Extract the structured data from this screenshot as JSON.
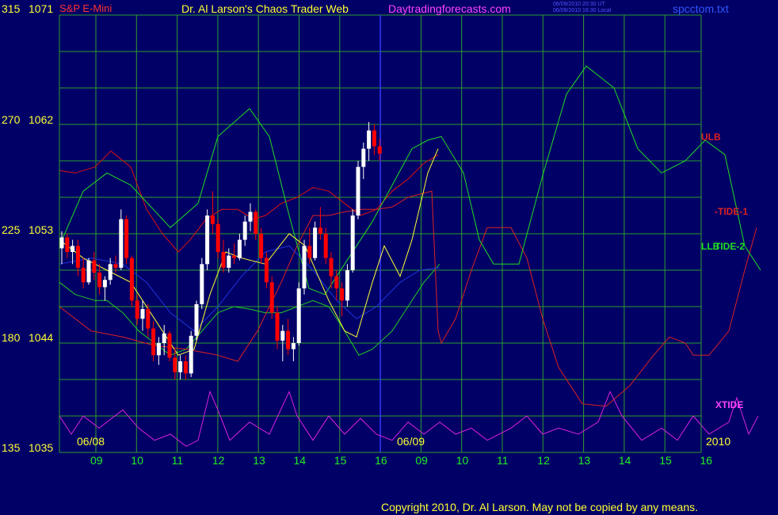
{
  "header": {
    "left_title": "S&P E-Mini",
    "center_title": "Dr. Al Larson's Chaos Trader Web",
    "site": "Daytradingforecasts.com",
    "timestamp_1": "06/09/2010 20:30 UT",
    "timestamp_2": "06/09/2010 16:30 Local",
    "file": "spcctom.txt"
  },
  "footer": {
    "copyright": "Copyright 2010, Dr. Al Larson. May not be copied by any means."
  },
  "colors": {
    "background": "#000066",
    "grid": "#2e9e2e",
    "price_up": "#ffffff",
    "price_down": "#ff0000",
    "ulb": "#dd1111",
    "llb": "#22cc22",
    "tide1": "#dd2222",
    "tide2": "#22dd22",
    "xtide": "#dd22dd",
    "yellow": "#ffff33",
    "blue": "#2233dd",
    "divider": "#3333ff"
  },
  "chart_data": {
    "type": "line",
    "title": "S&P E-Mini",
    "y_left_ticks": [
      {
        "osc": "315",
        "price": "1071"
      },
      {
        "osc": "270",
        "price": "1062"
      },
      {
        "osc": "225",
        "price": "1053"
      },
      {
        "osc": "180",
        "price": "1044"
      },
      {
        "osc": "135",
        "price": "1035"
      }
    ],
    "ylim": [
      1035,
      1071
    ],
    "x_labels": [
      "09",
      "10",
      "11",
      "12",
      "13",
      "14",
      "15",
      "16",
      "09",
      "10",
      "11",
      "12",
      "13",
      "14",
      "15",
      "16"
    ],
    "date_labels": [
      "06/08",
      "06/09"
    ],
    "year_label": "2010",
    "series_labels": [
      "ULB",
      "-TIDE-1",
      "LLB",
      "TIDE-2",
      "XTIDE"
    ],
    "price_bars": [
      [
        0,
        1051.8,
        1053.2,
        1050.5,
        1052.7
      ],
      [
        1,
        1052.7,
        1053,
        1051,
        1051.5
      ],
      [
        2,
        1051.5,
        1052.5,
        1050.5,
        1052
      ],
      [
        3,
        1052,
        1052.5,
        1049.5,
        1050.2
      ],
      [
        4,
        1050.2,
        1051,
        1048.5,
        1049
      ],
      [
        5,
        1049,
        1051,
        1048.8,
        1050.8
      ],
      [
        6,
        1050.8,
        1051.5,
        1049.2,
        1049.8
      ],
      [
        7,
        1049.8,
        1050.5,
        1048,
        1048.6
      ],
      [
        8,
        1048.6,
        1049.5,
        1047.5,
        1049.2
      ],
      [
        9,
        1049.2,
        1051,
        1048.8,
        1050.5
      ],
      [
        10,
        1050.5,
        1051.2,
        1049.8,
        1050.2
      ],
      [
        11,
        1050.2,
        1055,
        1050,
        1054.2
      ],
      [
        12,
        1054.2,
        1054.5,
        1050.5,
        1051
      ],
      [
        13,
        1051,
        1051.2,
        1047,
        1047.5
      ],
      [
        14,
        1047.5,
        1048,
        1045.5,
        1046
      ],
      [
        15,
        1046,
        1047.5,
        1045,
        1046.8
      ],
      [
        16,
        1046.8,
        1047.2,
        1044.5,
        1045.2
      ],
      [
        17,
        1045.2,
        1045.8,
        1042.5,
        1043
      ],
      [
        18,
        1043,
        1044.5,
        1042.2,
        1044
      ],
      [
        19,
        1044,
        1045.5,
        1043,
        1044.8
      ],
      [
        20,
        1044.8,
        1045,
        1042.5,
        1042.8
      ],
      [
        21,
        1042.8,
        1043.5,
        1041,
        1041.6
      ],
      [
        22,
        1041.6,
        1043,
        1041,
        1042.5
      ],
      [
        23,
        1042.5,
        1043,
        1041,
        1041.5
      ],
      [
        24,
        1041.5,
        1045,
        1041.2,
        1044.6
      ],
      [
        25,
        1044.6,
        1047.5,
        1044.2,
        1047.2
      ],
      [
        26,
        1047.2,
        1051,
        1046.8,
        1050.5
      ],
      [
        27,
        1050.5,
        1055,
        1050,
        1054.5
      ],
      [
        28,
        1054.5,
        1056.5,
        1053,
        1053.8
      ],
      [
        29,
        1053.8,
        1054.2,
        1051,
        1051.5
      ],
      [
        30,
        1051.5,
        1052.5,
        1049.8,
        1050.2
      ],
      [
        31,
        1050.2,
        1051.8,
        1049.8,
        1051.2
      ],
      [
        32,
        1051.2,
        1052.2,
        1050.5,
        1051
      ],
      [
        33,
        1051,
        1053,
        1050.8,
        1052.5
      ],
      [
        34,
        1052.5,
        1054.5,
        1052,
        1054
      ],
      [
        35,
        1054,
        1055.5,
        1053.2,
        1054.8
      ],
      [
        36,
        1054.8,
        1055,
        1052.5,
        1053
      ],
      [
        37,
        1053,
        1053.5,
        1050.5,
        1051
      ],
      [
        38,
        1051,
        1051.5,
        1048.5,
        1049
      ],
      [
        39,
        1049,
        1049.5,
        1046,
        1046.5
      ],
      [
        40,
        1046.5,
        1047,
        1043.5,
        1044.2
      ],
      [
        41,
        1044.2,
        1045.5,
        1042.5,
        1045
      ],
      [
        42,
        1045,
        1046,
        1043,
        1043.5
      ],
      [
        43,
        1043.5,
        1044.5,
        1042.5,
        1044
      ],
      [
        44,
        1044,
        1049,
        1043.8,
        1048.5
      ],
      [
        45,
        1048.5,
        1052.5,
        1048,
        1052
      ],
      [
        46,
        1052,
        1053.5,
        1050.5,
        1051
      ],
      [
        47,
        1051,
        1054,
        1050.8,
        1053.5
      ],
      [
        48,
        1053.5,
        1055.2,
        1052.5,
        1053
      ],
      [
        49,
        1053,
        1053.5,
        1050.5,
        1051
      ],
      [
        50,
        1051,
        1051.5,
        1048.5,
        1049.5
      ],
      [
        51,
        1049.5,
        1050,
        1047.5,
        1048.5
      ],
      [
        52,
        1048.5,
        1049,
        1046.2,
        1047.5
      ],
      [
        53,
        1047.5,
        1050.5,
        1047,
        1050
      ],
      [
        54,
        1050,
        1055,
        1049.8,
        1054.5
      ],
      [
        55,
        1054.5,
        1059,
        1054.2,
        1058.5
      ],
      [
        56,
        1058.5,
        1060.5,
        1057.5,
        1060
      ],
      [
        57,
        1060,
        1062.2,
        1059,
        1061.5
      ],
      [
        58,
        1061.5,
        1062,
        1059.5,
        1060.2
      ],
      [
        59,
        1060.2,
        1060.8,
        1059,
        1059.6
      ]
    ],
    "ulb": [
      [
        0,
        1058.2
      ],
      [
        20,
        1058
      ],
      [
        45,
        1058.5
      ],
      [
        65,
        1059.8
      ],
      [
        90,
        1058.5
      ],
      [
        110,
        1055
      ],
      [
        130,
        1053
      ],
      [
        150,
        1051.5
      ],
      [
        165,
        1052.5
      ],
      [
        185,
        1054.2
      ],
      [
        205,
        1055
      ],
      [
        225,
        1055
      ],
      [
        245,
        1054.2
      ],
      [
        260,
        1054.5
      ],
      [
        280,
        1055.5
      ],
      [
        300,
        1056
      ],
      [
        320,
        1056.8
      ],
      [
        340,
        1056.5
      ],
      [
        360,
        1055.5
      ],
      [
        380,
        1054.5
      ],
      [
        400,
        1055
      ],
      [
        420,
        1056.5
      ],
      [
        440,
        1057.5
      ],
      [
        460,
        1058.8
      ],
      [
        478,
        1059.5
      ]
    ],
    "llb": [
      [
        0,
        1049
      ],
      [
        20,
        1048
      ],
      [
        45,
        1047.5
      ],
      [
        60,
        1047.5
      ],
      [
        80,
        1046.5
      ],
      [
        100,
        1045
      ],
      [
        120,
        1044
      ],
      [
        140,
        1043
      ],
      [
        160,
        1043.5
      ],
      [
        180,
        1045
      ],
      [
        200,
        1046.5
      ],
      [
        220,
        1047
      ],
      [
        240,
        1046.8
      ],
      [
        260,
        1046.5
      ],
      [
        280,
        1046.5
      ],
      [
        300,
        1047
      ],
      [
        320,
        1047.5
      ],
      [
        340,
        1047
      ],
      [
        360,
        1045
      ],
      [
        378,
        1043
      ],
      [
        395,
        1043.5
      ],
      [
        420,
        1045
      ],
      [
        440,
        1047
      ],
      [
        460,
        1049
      ],
      [
        480,
        1050.5
      ]
    ],
    "tide1": [
      [
        0,
        1047
      ],
      [
        40,
        1045
      ],
      [
        80,
        1044.5
      ],
      [
        120,
        1043.8
      ],
      [
        160,
        1043.5
      ],
      [
        200,
        1043
      ],
      [
        225,
        1042.5
      ],
      [
        250,
        1045
      ],
      [
        280,
        1049
      ],
      [
        300,
        1052
      ],
      [
        320,
        1054.5
      ],
      [
        340,
        1054.5
      ],
      [
        360,
        1054.8
      ],
      [
        380,
        1055
      ],
      [
        400,
        1055
      ],
      [
        420,
        1055.2
      ],
      [
        440,
        1056
      ],
      [
        470,
        1056.5
      ],
      [
        478,
        1045
      ],
      [
        482,
        1044
      ],
      [
        500,
        1046
      ],
      [
        520,
        1050
      ],
      [
        540,
        1053.5
      ],
      [
        570,
        1053.5
      ],
      [
        590,
        1051
      ],
      [
        610,
        1046
      ],
      [
        630,
        1042
      ],
      [
        660,
        1039
      ],
      [
        690,
        1038.8
      ],
      [
        720,
        1040.5
      ],
      [
        750,
        1043
      ],
      [
        770,
        1044.5
      ],
      [
        790,
        1044
      ],
      [
        800,
        1043
      ],
      [
        820,
        1043
      ],
      [
        845,
        1045
      ],
      [
        865,
        1050
      ],
      [
        880,
        1053.5
      ]
    ],
    "tide2": [
      [
        0,
        1052
      ],
      [
        30,
        1056.5
      ],
      [
        60,
        1058
      ],
      [
        90,
        1057
      ],
      [
        140,
        1053.5
      ],
      [
        175,
        1055.5
      ],
      [
        200,
        1061
      ],
      [
        240,
        1063.3
      ],
      [
        265,
        1061
      ],
      [
        290,
        1054.5
      ],
      [
        315,
        1048.5
      ],
      [
        335,
        1048
      ],
      [
        365,
        1051
      ],
      [
        395,
        1054
      ],
      [
        420,
        1057
      ],
      [
        445,
        1060
      ],
      [
        465,
        1060.7
      ],
      [
        482,
        1061
      ],
      [
        510,
        1058
      ],
      [
        530,
        1052.5
      ],
      [
        548,
        1050.5
      ],
      [
        580,
        1050.5
      ],
      [
        610,
        1057.8
      ],
      [
        640,
        1064.5
      ],
      [
        665,
        1066.8
      ],
      [
        700,
        1065
      ],
      [
        730,
        1060
      ],
      [
        760,
        1058
      ],
      [
        790,
        1059
      ],
      [
        815,
        1060.7
      ],
      [
        840,
        1059.5
      ],
      [
        865,
        1052
      ],
      [
        885,
        1050
      ]
    ],
    "xtide": [
      [
        0,
        1038
      ],
      [
        15,
        1036.5
      ],
      [
        30,
        1038
      ],
      [
        50,
        1037
      ],
      [
        80,
        1038.5
      ],
      [
        100,
        1037
      ],
      [
        120,
        1036
      ],
      [
        140,
        1036.5
      ],
      [
        160,
        1035.5
      ],
      [
        175,
        1036
      ],
      [
        190,
        1040
      ],
      [
        200,
        1038.5
      ],
      [
        215,
        1036
      ],
      [
        240,
        1037.5
      ],
      [
        265,
        1036.5
      ],
      [
        290,
        1040
      ],
      [
        300,
        1038
      ],
      [
        320,
        1036
      ],
      [
        340,
        1038
      ],
      [
        360,
        1036.5
      ],
      [
        380,
        1037.8
      ],
      [
        400,
        1036.5
      ],
      [
        420,
        1036
      ],
      [
        440,
        1037.5
      ],
      [
        460,
        1036.5
      ],
      [
        480,
        1037.5
      ],
      [
        500,
        1036.5
      ],
      [
        520,
        1037
      ],
      [
        540,
        1036
      ],
      [
        570,
        1037
      ],
      [
        590,
        1038
      ],
      [
        610,
        1036.5
      ],
      [
        630,
        1037
      ],
      [
        655,
        1036.5
      ],
      [
        680,
        1037.5
      ],
      [
        695,
        1040
      ],
      [
        710,
        1038
      ],
      [
        735,
        1036
      ],
      [
        760,
        1037
      ],
      [
        780,
        1036
      ],
      [
        800,
        1038
      ],
      [
        820,
        1036.5
      ],
      [
        845,
        1037.5
      ],
      [
        855,
        1039.5
      ],
      [
        870,
        1036.5
      ],
      [
        882,
        1038
      ]
    ],
    "yellow": [
      [
        0,
        1052.5
      ],
      [
        30,
        1051
      ],
      [
        60,
        1050
      ],
      [
        90,
        1049
      ],
      [
        120,
        1046
      ],
      [
        150,
        1043
      ],
      [
        170,
        1043.5
      ],
      [
        190,
        1048
      ],
      [
        210,
        1051.5
      ],
      [
        230,
        1051
      ],
      [
        260,
        1050.5
      ],
      [
        290,
        1053
      ],
      [
        310,
        1052
      ],
      [
        340,
        1047.5
      ],
      [
        360,
        1045
      ],
      [
        375,
        1044.5
      ],
      [
        395,
        1049
      ],
      [
        410,
        1052
      ],
      [
        430,
        1049.5
      ],
      [
        445,
        1052.5
      ],
      [
        465,
        1058
      ],
      [
        478,
        1060
      ]
    ],
    "blue": [
      [
        0,
        1050.5
      ],
      [
        40,
        1051
      ],
      [
        80,
        1050.5
      ],
      [
        110,
        1049
      ],
      [
        140,
        1046.5
      ],
      [
        170,
        1045
      ],
      [
        200,
        1047
      ],
      [
        230,
        1049.5
      ],
      [
        260,
        1051.5
      ],
      [
        290,
        1052
      ],
      [
        320,
        1050
      ],
      [
        350,
        1047.5
      ],
      [
        375,
        1046
      ],
      [
        400,
        1047
      ],
      [
        430,
        1049
      ],
      [
        455,
        1050
      ],
      [
        480,
        1050.2
      ]
    ]
  }
}
